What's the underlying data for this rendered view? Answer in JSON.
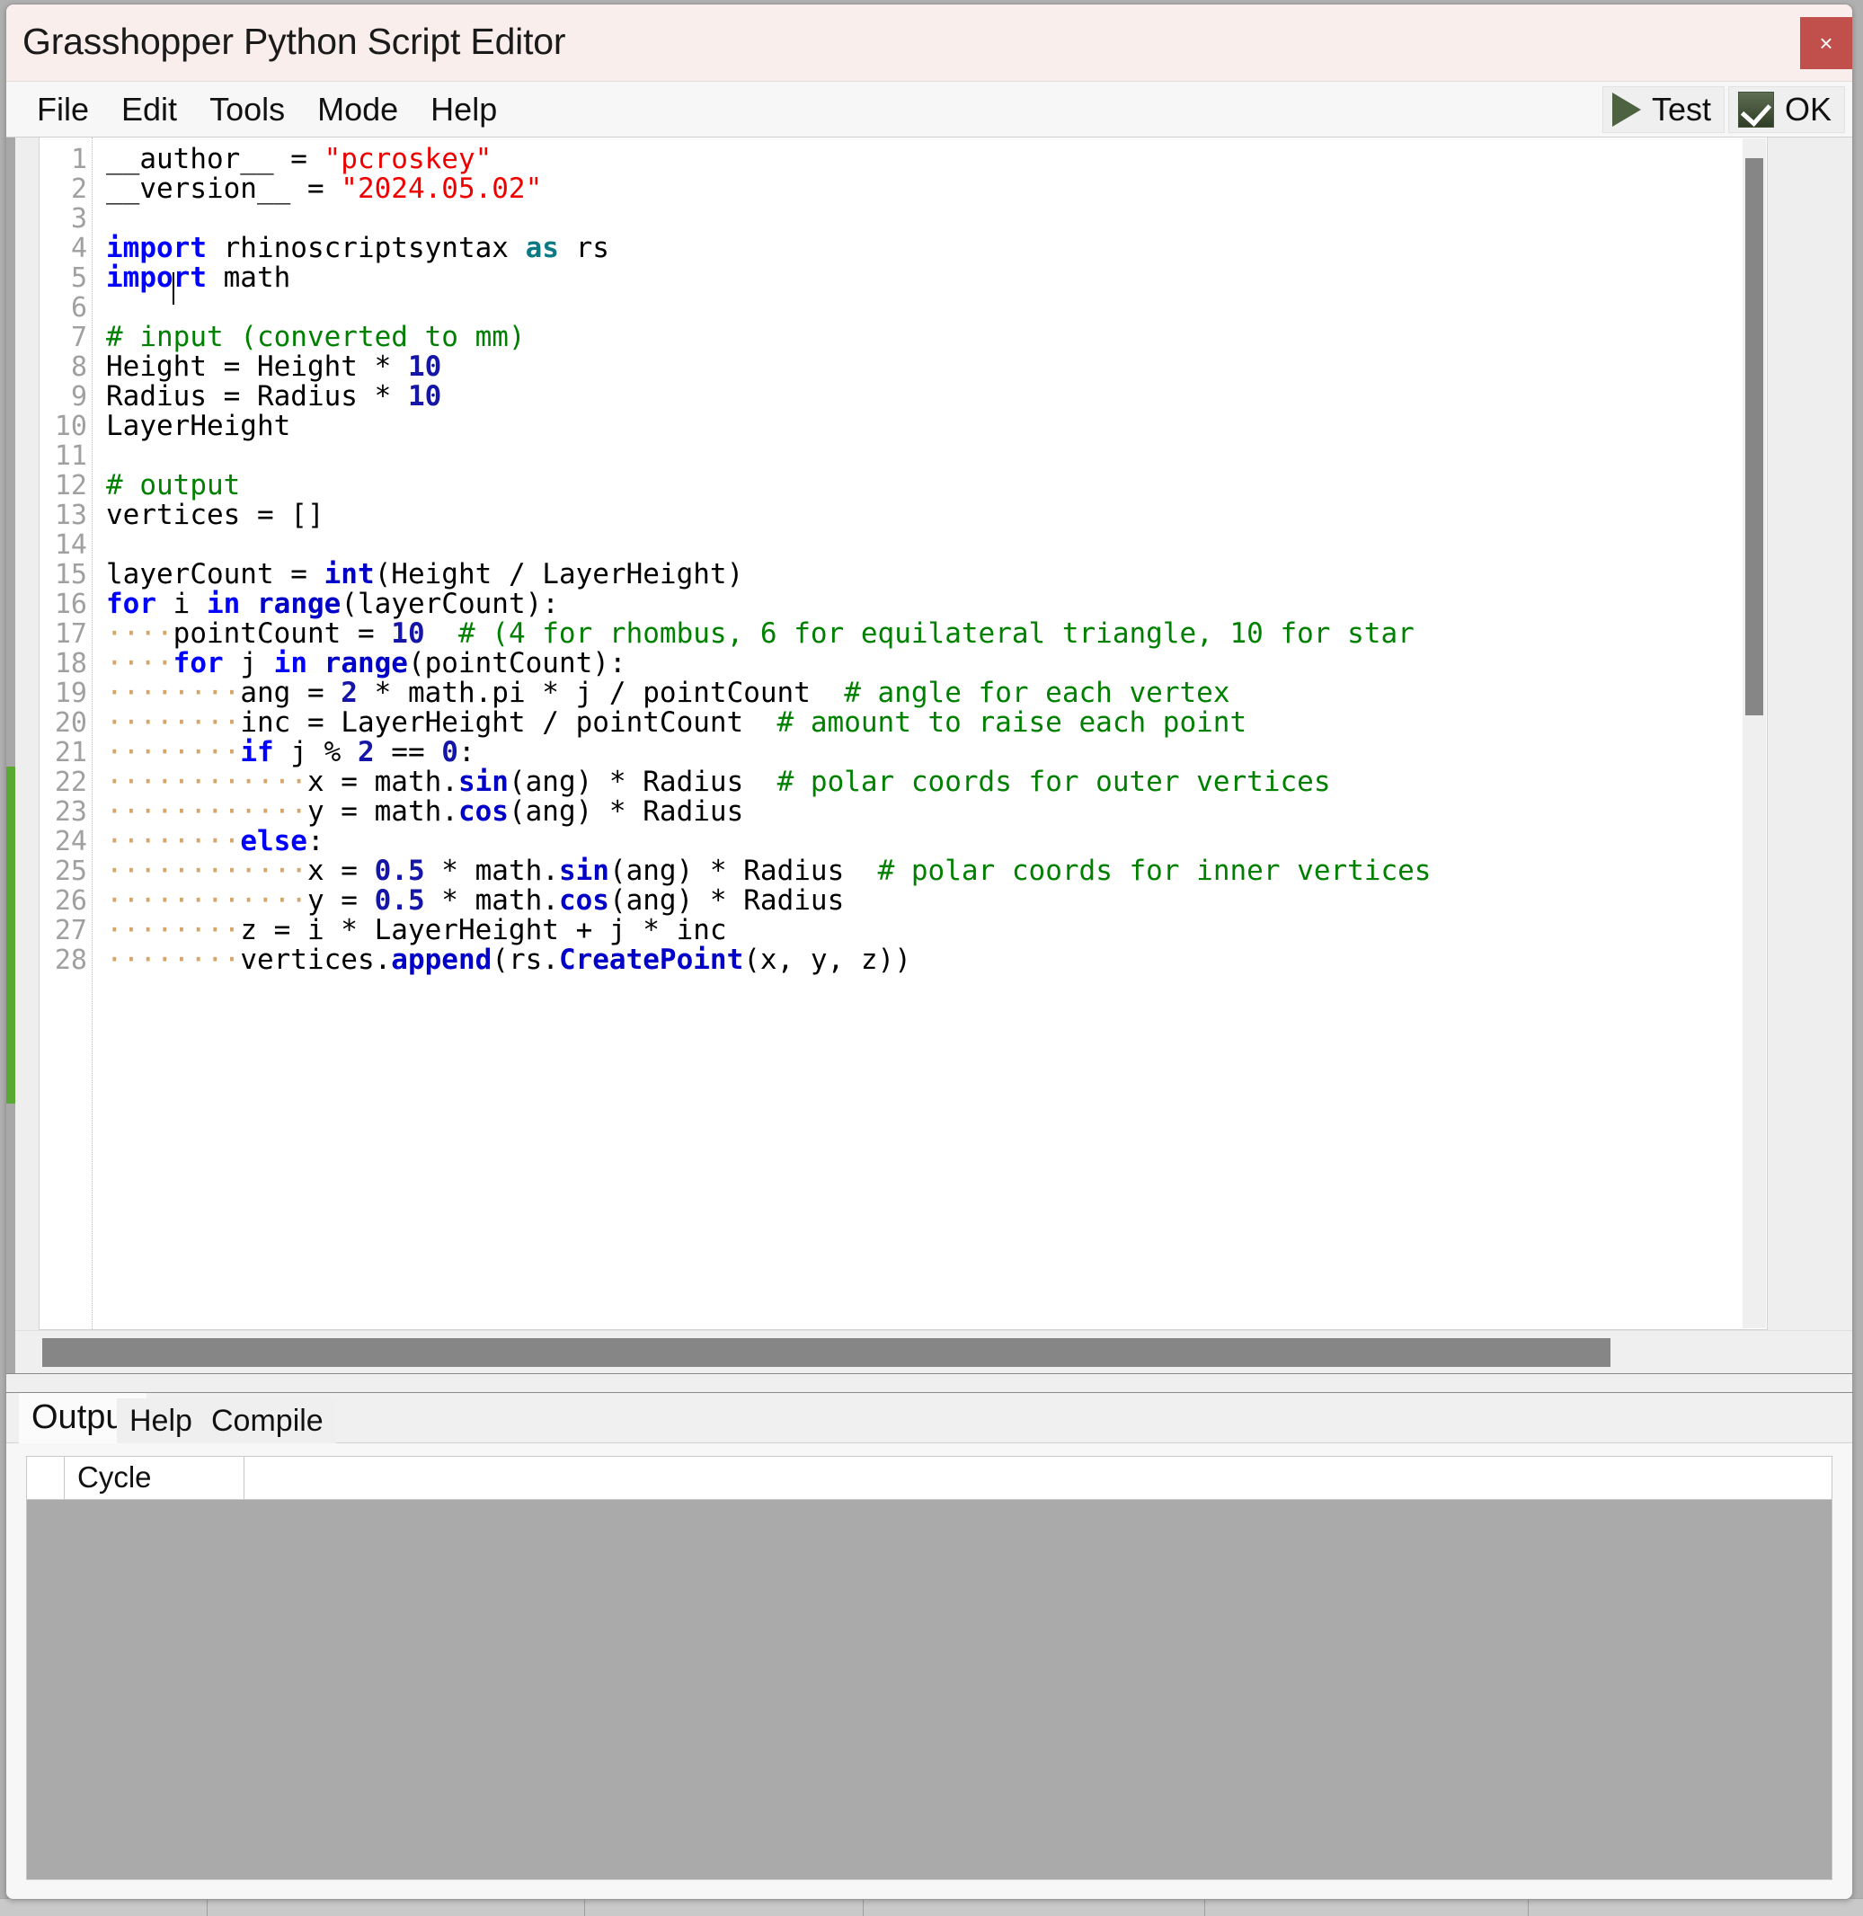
{
  "window": {
    "title": "Grasshopper Python Script Editor",
    "close_label": "×",
    "accent_title_bg": "#f9eeec",
    "close_bg": "#c1504d"
  },
  "menubar": {
    "items": [
      {
        "label": "File"
      },
      {
        "label": "Edit"
      },
      {
        "label": "Tools"
      },
      {
        "label": "Mode"
      },
      {
        "label": "Help"
      }
    ],
    "actions": [
      {
        "label": "Test",
        "icon": "play-icon"
      },
      {
        "label": "OK",
        "icon": "checkbox-checked-icon"
      }
    ]
  },
  "editor": {
    "line_numbers": [
      "1",
      "2",
      "3",
      "4",
      "5",
      "6",
      "7",
      "8",
      "9",
      "10",
      "11",
      "12",
      "13",
      "14",
      "15",
      "16",
      "17",
      "18",
      "19",
      "20",
      "21",
      "22",
      "23",
      "24",
      "25",
      "26",
      "27",
      "28"
    ],
    "code_lines": [
      "__author__ = \"pcroskey\"",
      "__version__ = \"2024.05.02\"",
      "",
      "import rhinoscriptsyntax as rs",
      "import math",
      "",
      "# input (converted to mm)",
      "Height = Height * 10",
      "Radius = Radius * 10",
      "LayerHeight",
      "",
      "# output",
      "vertices = []",
      "",
      "layerCount = int(Height / LayerHeight)",
      "for i in range(layerCount):",
      "····pointCount = 10  # (4 for rhombus, 6 for equilateral triangle, 10 for star",
      "····for j in range(pointCount):",
      "········ang = 2 * math.pi * j / pointCount  # angle for each vertex",
      "········inc = LayerHeight / pointCount  # amount to raise each point",
      "········if j % 2 == 0:",
      "············x = math.sin(ang) * Radius  # polar coords for outer vertices",
      "············y = math.cos(ang) * Radius",
      "········else:",
      "············x = 0.5 * math.sin(ang) * Radius  # polar coords for inner vertices",
      "············y = 0.5 * math.cos(ang) * Radius",
      "········z = i * LayerHeight + j * inc",
      "········vertices.append(rs.CreatePoint(x, y, z))"
    ],
    "change_marker_color": "#58a832"
  },
  "bottom_panel": {
    "tabs": [
      {
        "label": "Output",
        "active": true
      },
      {
        "label": "Help",
        "active": false
      },
      {
        "label": "Compile",
        "active": false
      }
    ],
    "grid": {
      "columns": [
        "Cycle"
      ],
      "rows": []
    }
  }
}
